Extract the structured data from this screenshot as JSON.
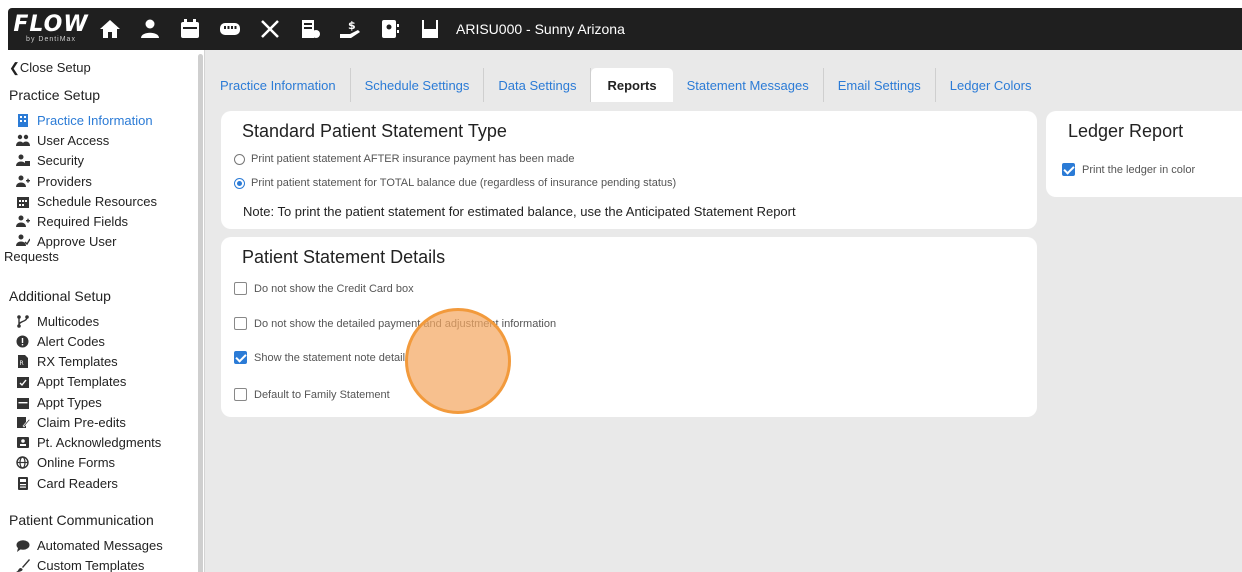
{
  "topbar": {
    "logo_text": "FLOW",
    "logo_sub": "by DentiMax",
    "patient": "ARISU000 - Sunny Arizona",
    "icons": [
      "home-icon",
      "person-icon",
      "calendar-icon",
      "teeth-chart-icon",
      "tools-icon",
      "billing-icon",
      "payment-icon",
      "contact-card-icon",
      "save-icon"
    ]
  },
  "sidebar": {
    "close_label": "❮Close Setup",
    "practice_setup": {
      "title": "Practice Setup",
      "items": [
        {
          "label": "Practice Information",
          "icon": "building-icon",
          "active": true
        },
        {
          "label": "User Access",
          "icon": "users-icon"
        },
        {
          "label": "Security",
          "icon": "user-lock-icon"
        },
        {
          "label": "Providers",
          "icon": "user-plus-icon"
        },
        {
          "label": "Schedule Resources",
          "icon": "calendar-grid-icon"
        },
        {
          "label": "Required Fields",
          "icon": "user-plus-icon"
        },
        {
          "label": "Approve User Requests",
          "icon": "user-check-icon"
        }
      ]
    },
    "additional_setup": {
      "title": "Additional Setup",
      "items": [
        {
          "label": "Multicodes",
          "icon": "branch-icon"
        },
        {
          "label": "Alert Codes",
          "icon": "alert-icon"
        },
        {
          "label": "RX Templates",
          "icon": "rx-icon"
        },
        {
          "label": "Appt Templates",
          "icon": "calendar-check-icon"
        },
        {
          "label": "Appt Types",
          "icon": "calendar-icon"
        },
        {
          "label": "Claim Pre-edits",
          "icon": "edit-icon"
        },
        {
          "label": "Pt. Acknowledgments",
          "icon": "id-badge-icon"
        },
        {
          "label": "Online Forms",
          "icon": "globe-icon"
        },
        {
          "label": "Card Readers",
          "icon": "card-reader-icon"
        }
      ]
    },
    "patient_communication": {
      "title": "Patient Communication",
      "items": [
        {
          "label": "Automated Messages",
          "icon": "chat-icon"
        },
        {
          "label": "Custom Templates",
          "icon": "brush-icon"
        }
      ]
    }
  },
  "tabs": [
    {
      "label": "Practice Information"
    },
    {
      "label": "Schedule Settings"
    },
    {
      "label": "Data Settings"
    },
    {
      "label": "Reports",
      "active": true
    },
    {
      "label": "Statement Messages"
    },
    {
      "label": "Email Settings"
    },
    {
      "label": "Ledger Colors"
    }
  ],
  "statement_type": {
    "title": "Standard Patient Statement Type",
    "options": [
      {
        "label": "Print patient statement AFTER insurance payment has been made",
        "selected": false
      },
      {
        "label": "Print patient statement for TOTAL balance due (regardless of insurance pending status)",
        "selected": true
      }
    ],
    "note": "Note: To print the patient statement for estimated balance, use the Anticipated Statement Report"
  },
  "statement_details": {
    "title": "Patient Statement Details",
    "options": [
      {
        "label": "Do not show the Credit Card box",
        "checked": false
      },
      {
        "label": "Do not show the detailed payment and adjustment information",
        "checked": false
      },
      {
        "label": "Show the statement note detail",
        "checked": true
      },
      {
        "label": "Default to Family Statement",
        "checked": false
      }
    ]
  },
  "ledger_report": {
    "title": "Ledger Report",
    "option": {
      "label": "Print the ledger in color",
      "checked": true
    }
  },
  "colors": {
    "accent": "#2b7bd6",
    "topbar": "#1f1f1f",
    "cursor_highlight": "#f29a3c"
  }
}
